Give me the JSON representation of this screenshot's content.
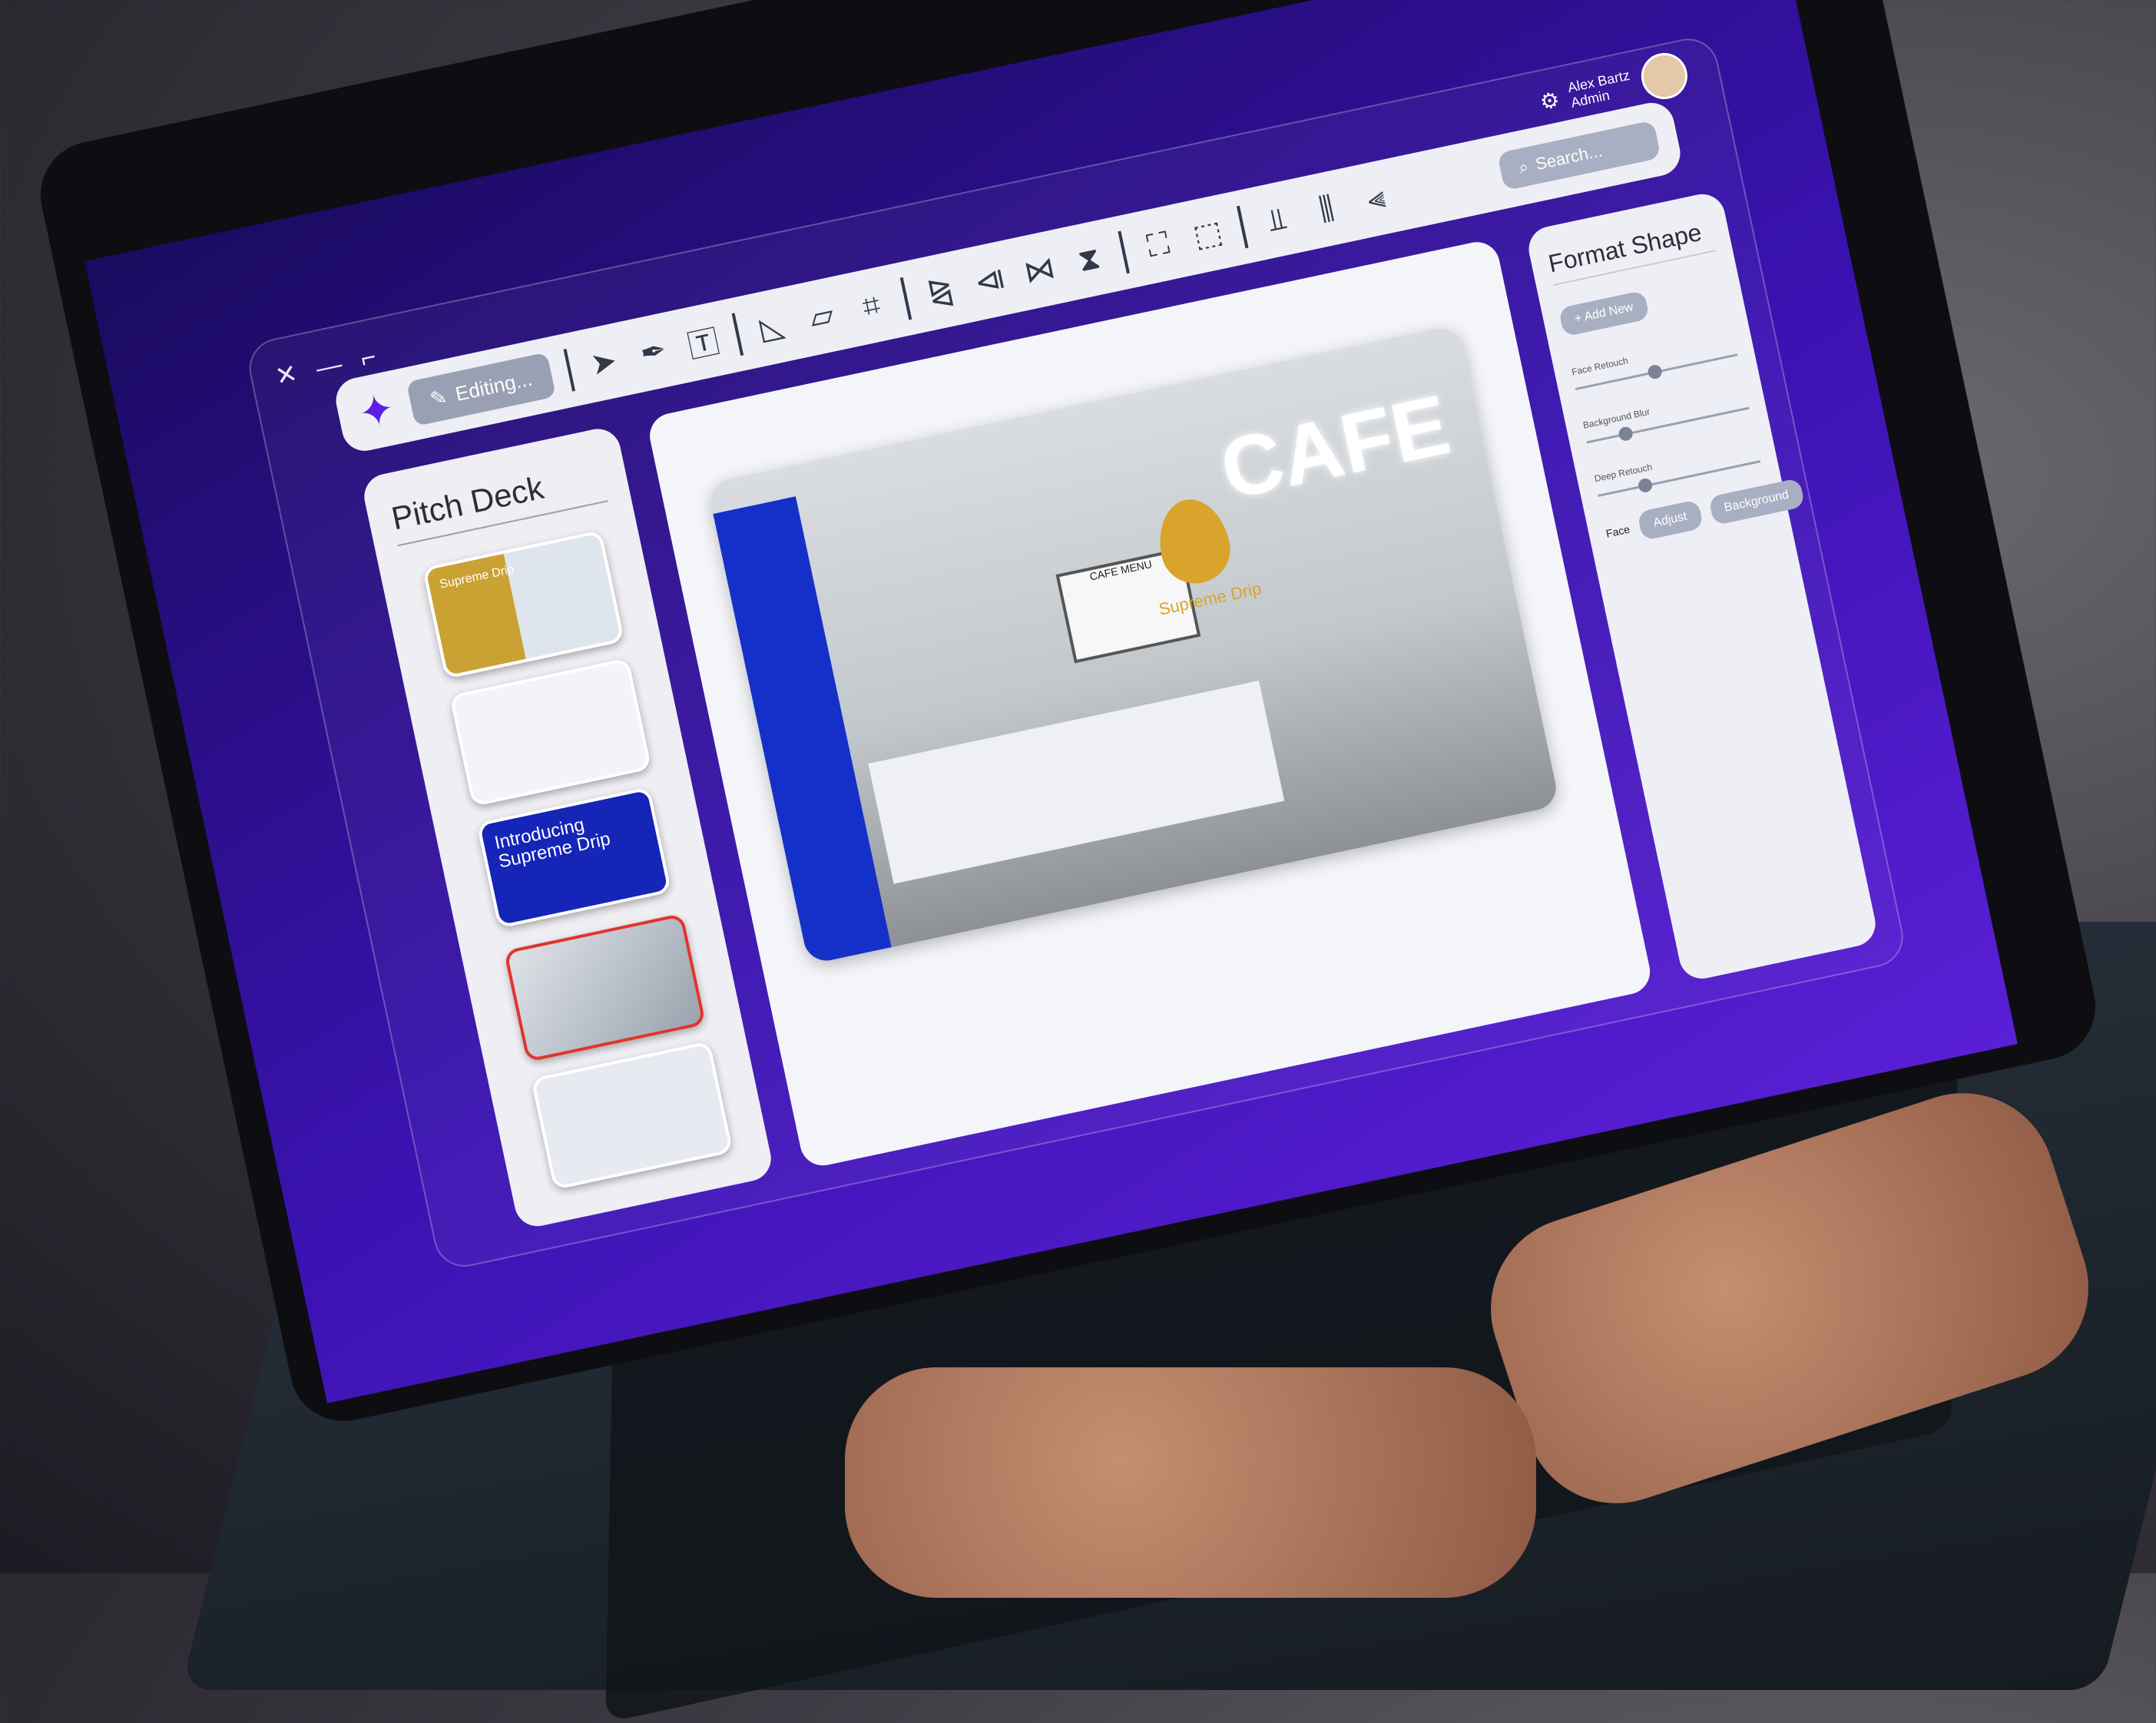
{
  "window": {
    "controls": "✕ — ⌐"
  },
  "user": {
    "name": "Alex Bartz",
    "role": "Admin"
  },
  "toolbar": {
    "editing_label": "Editing...",
    "search_placeholder": "Search..."
  },
  "slides_panel": {
    "title": "Pitch Deck",
    "slide1_text": "Supreme Drip",
    "slide3_text": "Introducing Supreme Drip"
  },
  "canvas": {
    "sign_text": "CAFE",
    "brand_text": "Supreme Drip",
    "menu_text": "CAFE MENU"
  },
  "format_panel": {
    "title": "Format Shape",
    "add_new": "+ Add New",
    "slider1": "Face Retouch",
    "slider2": "Background Blur",
    "slider3": "Deep Retouch",
    "face_label": "Face",
    "btn_adjust": "Adjust",
    "btn_background": "Background"
  }
}
